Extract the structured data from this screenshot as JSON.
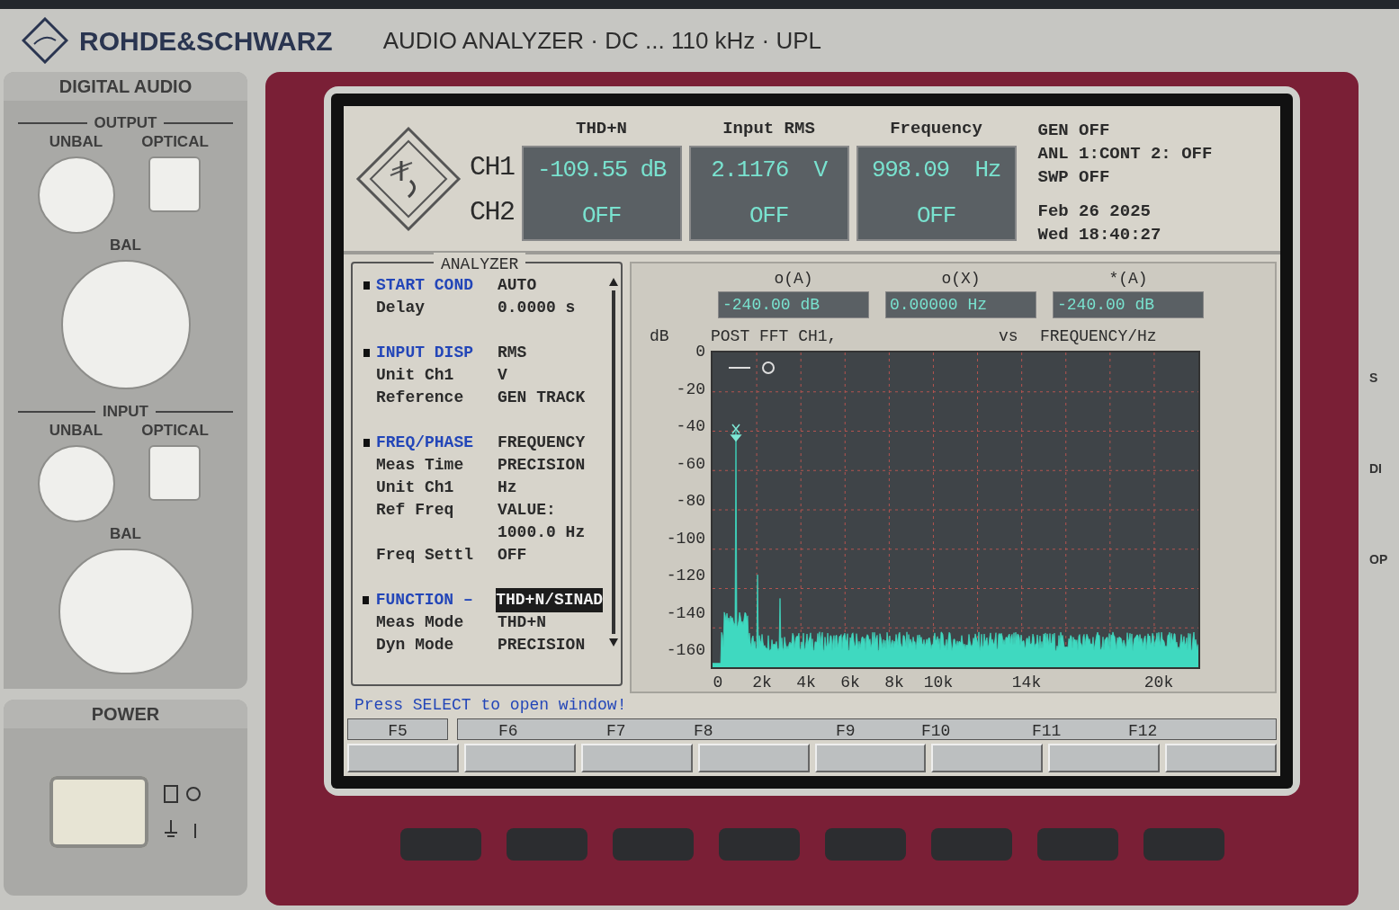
{
  "header": {
    "brand": "ROHDE&SCHWARZ",
    "model": "AUDIO ANALYZER · DC ... 110 kHz · UPL"
  },
  "left_panel": {
    "title": "DIGITAL AUDIO",
    "groups": [
      {
        "title": "OUTPUT",
        "connectors": [
          {
            "label": "UNBAL",
            "kind": "round"
          },
          {
            "label": "OPTICAL",
            "kind": "square"
          },
          {
            "label": "BAL",
            "kind": "round_large"
          }
        ]
      },
      {
        "title": "INPUT",
        "connectors": [
          {
            "label": "UNBAL",
            "kind": "round"
          },
          {
            "label": "OPTICAL",
            "kind": "square"
          },
          {
            "label": "BAL",
            "kind": "xlr"
          }
        ]
      }
    ],
    "power": {
      "title": "POWER",
      "on": true
    }
  },
  "right_edge_labels": [
    "S",
    "DI",
    "OP"
  ],
  "screen": {
    "channels": [
      "CH1",
      "CH2"
    ],
    "readouts": [
      {
        "title": "THD+N",
        "ch1": "-109.55 dB",
        "ch2": "OFF"
      },
      {
        "title": "Input RMS",
        "ch1": "2.1176  V",
        "ch2": "OFF"
      },
      {
        "title": "Frequency",
        "ch1": "998.09  Hz",
        "ch2": "OFF"
      }
    ],
    "status": [
      "GEN OFF",
      "ANL 1:CONT 2: OFF",
      "SWP OFF"
    ],
    "date": "Feb 26 2025",
    "time": "Wed 18:40:27",
    "analyzer": {
      "title": "ANALYZER",
      "rows": [
        {
          "kind": "section",
          "label": "START COND",
          "value": "AUTO",
          "selected": false
        },
        {
          "kind": "param",
          "label": "Delay",
          "value": "0.0000 s",
          "selected": false
        },
        {
          "kind": "gap"
        },
        {
          "kind": "section",
          "label": "INPUT DISP",
          "value": "RMS",
          "selected": false
        },
        {
          "kind": "param",
          "label": "Unit Ch1",
          "value": "V",
          "selected": false
        },
        {
          "kind": "param",
          "label": "Reference",
          "value": "GEN TRACK",
          "selected": false
        },
        {
          "kind": "gap"
        },
        {
          "kind": "section",
          "label": "FREQ/PHASE",
          "value": "FREQUENCY",
          "selected": false
        },
        {
          "kind": "param",
          "label": "Meas Time",
          "value": "PRECISION",
          "selected": false
        },
        {
          "kind": "param",
          "label": "Unit Ch1",
          "value": "Hz",
          "selected": false
        },
        {
          "kind": "param",
          "label": "Ref Freq",
          "value": "VALUE:",
          "selected": false
        },
        {
          "kind": "continuation",
          "value": "1000.0 Hz",
          "selected": false
        },
        {
          "kind": "param",
          "label": "Freq Settl",
          "value": "OFF",
          "selected": false
        },
        {
          "kind": "gap"
        },
        {
          "kind": "section",
          "label": "FUNCTION –",
          "value": "THD+N/SINAD",
          "selected": true
        },
        {
          "kind": "param",
          "label": "Meas Mode",
          "value": "THD+N",
          "selected": false
        },
        {
          "kind": "param",
          "label": "Dyn Mode",
          "value": "PRECISION",
          "selected": false
        }
      ]
    },
    "graph": {
      "markers": [
        {
          "label": "o(A)",
          "value": "-240.00 dB"
        },
        {
          "label": "o(X)",
          "value": "0.00000 Hz"
        },
        {
          "label": "*(A)",
          "value": "-240.00 dB"
        }
      ],
      "y_unit": "dB",
      "title": "POST FFT CH1,",
      "vs": "vs",
      "x_title": "FREQUENCY/Hz",
      "yticks": [
        "0",
        "-20",
        "-40",
        "-60",
        "-80",
        "-100",
        "-120",
        "-140",
        "-160"
      ],
      "xticks": [
        "0",
        "2k",
        "4k",
        "6k",
        "8k",
        "10k",
        "14k",
        "20k"
      ]
    },
    "message": "Press SELECT to open window!",
    "softkeys": [
      "F5",
      "F6",
      "F7",
      "F8",
      "F9",
      "F10",
      "F11",
      "F12"
    ]
  }
}
